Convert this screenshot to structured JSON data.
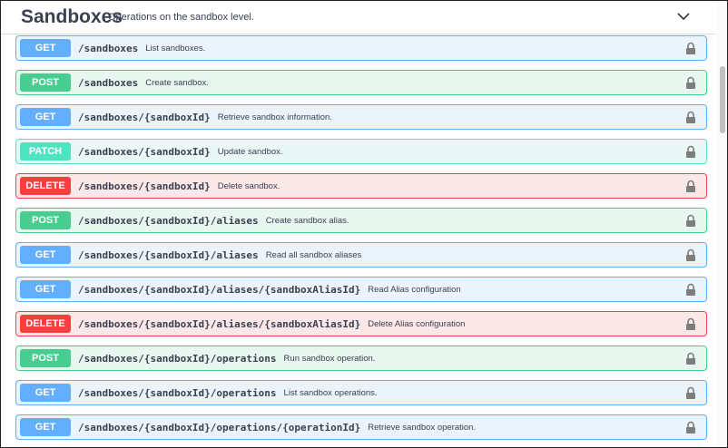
{
  "header": {
    "title": "Sandboxes",
    "subtitle": "Operations on the sandbox level."
  },
  "operations": [
    {
      "method": "GET",
      "path": "/sandboxes",
      "desc": "List sandboxes."
    },
    {
      "method": "POST",
      "path": "/sandboxes",
      "desc": "Create sandbox."
    },
    {
      "method": "GET",
      "path": "/sandboxes/{sandboxId}",
      "desc": "Retrieve sandbox information."
    },
    {
      "method": "PATCH",
      "path": "/sandboxes/{sandboxId}",
      "desc": "Update sandbox."
    },
    {
      "method": "DELETE",
      "path": "/sandboxes/{sandboxId}",
      "desc": "Delete sandbox."
    },
    {
      "method": "POST",
      "path": "/sandboxes/{sandboxId}/aliases",
      "desc": "Create sandbox alias."
    },
    {
      "method": "GET",
      "path": "/sandboxes/{sandboxId}/aliases",
      "desc": "Read all sandbox aliases"
    },
    {
      "method": "GET",
      "path": "/sandboxes/{sandboxId}/aliases/{sandboxAliasId}",
      "desc": "Read Alias configuration"
    },
    {
      "method": "DELETE",
      "path": "/sandboxes/{sandboxId}/aliases/{sandboxAliasId}",
      "desc": "Delete Alias configuration"
    },
    {
      "method": "POST",
      "path": "/sandboxes/{sandboxId}/operations",
      "desc": "Run sandbox operation."
    },
    {
      "method": "GET",
      "path": "/sandboxes/{sandboxId}/operations",
      "desc": "List sandbox operations."
    },
    {
      "method": "GET",
      "path": "/sandboxes/{sandboxId}/operations/{operationId}",
      "desc": "Retrieve sandbox operation."
    }
  ],
  "icons": {
    "lock": "lock-icon",
    "chevron": "chevron-down-icon"
  },
  "colors": {
    "get": "#61affe",
    "post": "#49cc90",
    "patch": "#50e3c2",
    "delete": "#f93e3e",
    "text": "#3b4151"
  }
}
